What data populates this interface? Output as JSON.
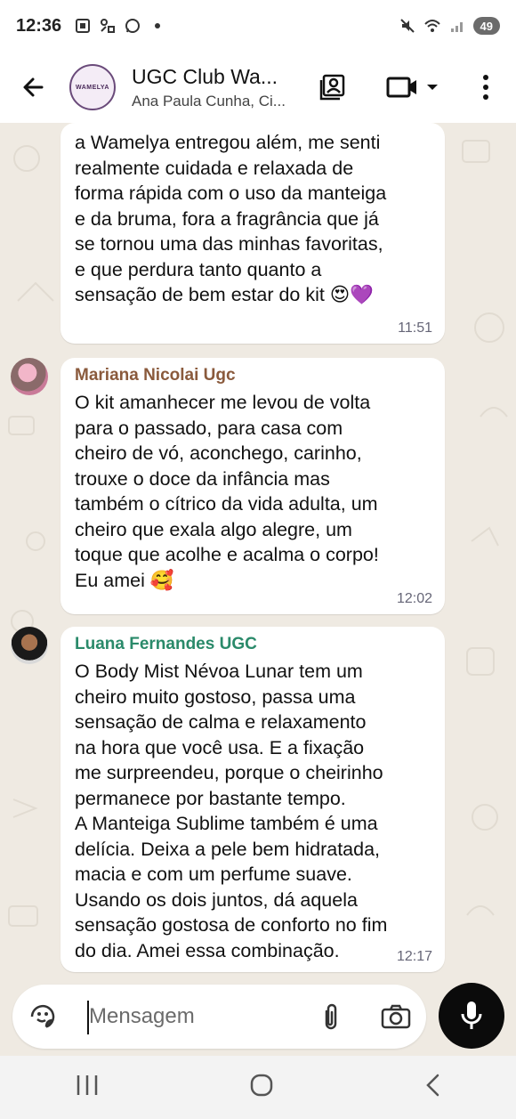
{
  "status_bar": {
    "time": "12:36",
    "battery": "49"
  },
  "header": {
    "title": "UGC Club Wa...",
    "subtitle": "Ana Paula Cunha, Ci...",
    "avatar_text": "WAMELYA"
  },
  "messages": [
    {
      "sender": "",
      "text": "a Wamelya entregou além, me senti\nrealmente cuidada e relaxada de\nforma rápida com o uso da manteiga\ne da bruma, fora a fragrância que já\nse tornou uma das minhas favoritas,\ne que perdura tanto quanto a\nsensação de bem estar do kit",
      "emoji": "😍💜",
      "time": "11:51"
    },
    {
      "sender": "Mariana Nicolai Ugc",
      "sender_color": "#8a5a3c",
      "text": "O kit amanhecer me levou de volta\npara o passado, para casa com\ncheiro de vó, aconchego, carinho,\ntrouxe o doce da infância mas\ntambém o cítrico da vida adulta, um\ncheiro que exala algo alegre, um\ntoque que acolhe e acalma o corpo!\nEu amei",
      "emoji": "🥰",
      "time": "12:02"
    },
    {
      "sender": "Luana Fernandes UGC",
      "sender_color": "#2a8a6a",
      "text": "O Body Mist Névoa Lunar tem um\ncheiro muito gostoso, passa uma\nsensação de calma e relaxamento\nna hora que você usa. E a fixação\nme surpreendeu, porque o cheirinho\npermanece por bastante tempo.\nA Manteiga Sublime também é uma\ndelícia. Deixa a pele bem hidratada,\nmacia e com um perfume suave.\nUsando os dois juntos, dá aquela\nsensação gostosa de conforto no fim\ndo dia. Amei essa combinação.",
      "emoji": "",
      "time": "12:17"
    }
  ],
  "input": {
    "placeholder": "Mensagem"
  },
  "icons": {
    "back": "arrow-left-icon",
    "contacts": "contact-card-icon",
    "video": "video-call-icon",
    "dropdown": "chevron-down-icon",
    "menu": "more-vertical-icon",
    "sticker": "sticker-icon",
    "attach": "paperclip-icon",
    "camera": "camera-icon",
    "mic": "microphone-icon"
  },
  "colors": {
    "chat_bg": "#efeae2",
    "bubble": "#ffffff",
    "mic_button": "#0b0b0b"
  }
}
